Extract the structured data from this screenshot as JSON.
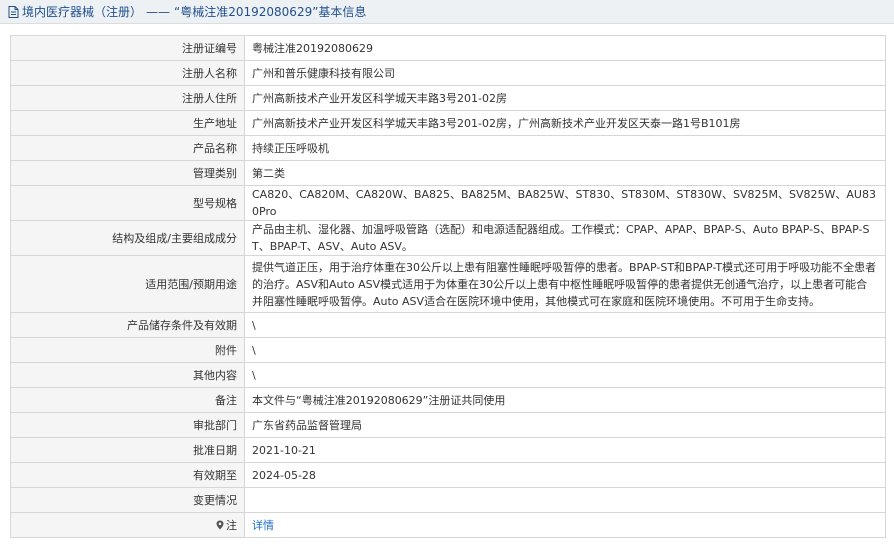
{
  "header": {
    "category": "境内医疗器械（注册）",
    "separator": "——",
    "title": "“粤械注准20192080629”基本信息"
  },
  "fields": [
    {
      "label": "注册证编号",
      "value": "粤械注准20192080629"
    },
    {
      "label": "注册人名称",
      "value": "广州和普乐健康科技有限公司"
    },
    {
      "label": "注册人住所",
      "value": "广州高新技术产业开发区科学城天丰路3号201-02房"
    },
    {
      "label": "生产地址",
      "value": "广州高新技术产业开发区科学城天丰路3号201-02房，广州高新技术产业开发区天泰一路1号B101房"
    },
    {
      "label": "产品名称",
      "value": "持续正压呼吸机"
    },
    {
      "label": "管理类别",
      "value": "第二类"
    },
    {
      "label": "型号规格",
      "value": "CA820、CA820M、CA820W、BA825、BA825M、BA825W、ST830、ST830M、ST830W、SV825M、SV825W、AU830Pro"
    },
    {
      "label": "结构及组成/主要组成成分",
      "value": "产品由主机、湿化器、加温呼吸管路（选配）和电源适配器组成。工作模式：CPAP、APAP、BPAP-S、Auto BPAP-S、BPAP-ST、BPAP-T、ASV、Auto ASV。"
    },
    {
      "label": "适用范围/预期用途",
      "value": "提供气道正压，用于治疗体重在30公斤以上患有阻塞性睡眠呼吸暂停的患者。BPAP-ST和BPAP-T模式还可用于呼吸功能不全患者的治疗。ASV和Auto ASV模式适用于为体重在30公斤以上患有中枢性睡眠呼吸暂停的患者提供无创通气治疗，以上患者可能合并阻塞性睡眠呼吸暂停。Auto ASV适合在医院环境中使用，其他模式可在家庭和医院环境使用。不可用于生命支持。"
    },
    {
      "label": "产品储存条件及有效期",
      "value": "\\"
    },
    {
      "label": "附件",
      "value": "\\"
    },
    {
      "label": "其他内容",
      "value": "\\"
    },
    {
      "label": "备注",
      "value": "本文件与“粤械注准20192080629”注册证共同使用"
    },
    {
      "label": "审批部门",
      "value": "广东省药品监督管理局"
    },
    {
      "label": "批准日期",
      "value": "2021-10-21"
    },
    {
      "label": "有效期至",
      "value": "2024-05-28"
    },
    {
      "label": "变更情况",
      "value": ""
    }
  ],
  "note": {
    "label": "注",
    "link_text": "详情"
  },
  "colors": {
    "header_text": "#1f4f8f",
    "link": "#1e6fc7",
    "label_bg": "#f5f5f5",
    "border": "#d6d6d6"
  }
}
